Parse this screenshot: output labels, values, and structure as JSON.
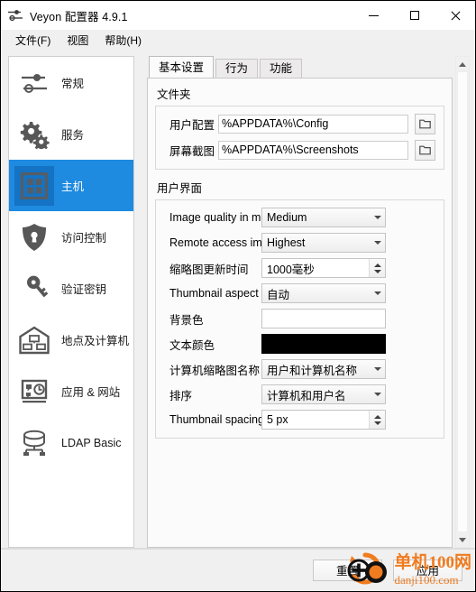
{
  "window": {
    "title": "Veyon 配置器 4.9.1",
    "app_icon": "sliders-icon",
    "controls": {
      "minimize": "minimize-icon",
      "maximize": "maximize-icon",
      "close": "close-icon"
    }
  },
  "menubar": {
    "items": [
      {
        "label": "文件(F)",
        "accel": "F"
      },
      {
        "label": "视图",
        "accel": ""
      },
      {
        "label": "帮助(H)",
        "accel": "H"
      }
    ]
  },
  "sidebar": {
    "items": [
      {
        "label": "常规",
        "icon": "sliders-icon",
        "selected": false
      },
      {
        "label": "服务",
        "icon": "gears-icon",
        "selected": false
      },
      {
        "label": "主机",
        "icon": "grid-squares-icon",
        "selected": true
      },
      {
        "label": "访问控制",
        "icon": "shield-keyhole-icon",
        "selected": false
      },
      {
        "label": "验证密钥",
        "icon": "key-icon",
        "selected": false
      },
      {
        "label": "地点及计算机",
        "icon": "house-computers-icon",
        "selected": false
      },
      {
        "label": "应用 & 网站",
        "icon": "app-clock-icon",
        "selected": false
      },
      {
        "label": "LDAP Basic",
        "icon": "database-icon",
        "selected": false
      }
    ]
  },
  "tabs": [
    {
      "label": "基本设置",
      "active": true
    },
    {
      "label": "行为",
      "active": false
    },
    {
      "label": "功能",
      "active": false
    }
  ],
  "groups": [
    {
      "title": "文件夹",
      "rows": [
        {
          "label": "用户配置",
          "control": "text",
          "value": "%APPDATA%\\Config",
          "button": "folder-icon"
        },
        {
          "label": "屏幕截图",
          "control": "text",
          "value": "%APPDATA%\\Screenshots",
          "button": "folder-icon"
        }
      ]
    },
    {
      "title": "用户界面",
      "rows": [
        {
          "label": "Image quality in monitori",
          "control": "combo",
          "value": "Medium"
        },
        {
          "label": "Remote access image qu",
          "control": "combo",
          "value": "Highest"
        },
        {
          "label": "缩略图更新时间",
          "control": "spin",
          "value": "1000毫秒"
        },
        {
          "label": "Thumbnail aspect ratio",
          "control": "combo",
          "value": "自动"
        },
        {
          "label": "背景色",
          "control": "color",
          "value": "#ffffff"
        },
        {
          "label": "文本颜色",
          "control": "color",
          "value": "#000000"
        },
        {
          "label": "计算机缩略图名称",
          "control": "combo",
          "value": "用户和计算机名称"
        },
        {
          "label": "排序",
          "control": "combo",
          "value": "计算机和用户名"
        },
        {
          "label": "Thumbnail spacing",
          "control": "spin",
          "value": "5 px"
        }
      ]
    }
  ],
  "footer": {
    "reset_label": "重置",
    "apply_label": "应用"
  },
  "watermark": {
    "line1": "单机100网",
    "line2": "danji100.com",
    "color": "#f07c20"
  },
  "colors": {
    "accent": "#1e8ae0",
    "accent_dark": "#1473c4",
    "window_bg": "#f0f0f0",
    "panel_bg": "#fbfbfb",
    "icon_gray": "#575757"
  }
}
